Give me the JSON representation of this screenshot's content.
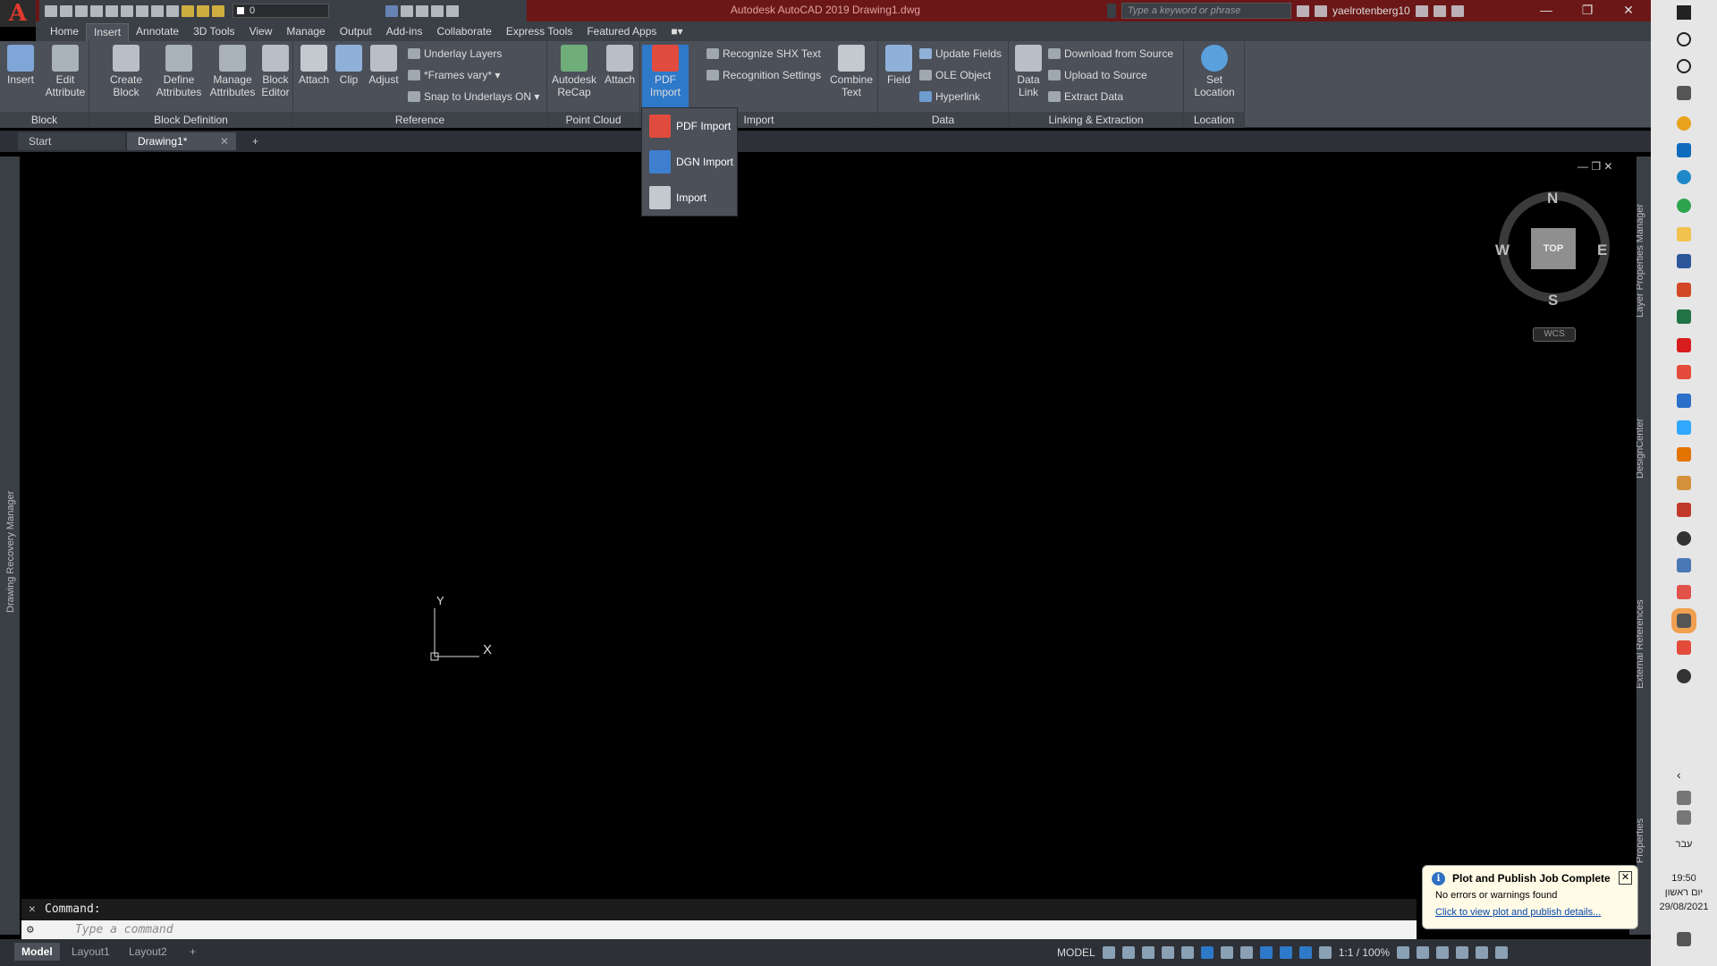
{
  "window": {
    "title": "Autodesk AutoCAD 2019   Drawing1.dwg",
    "search_placeholder": "Type a keyword or phrase",
    "user": "yaelrotenberg10",
    "layer_value": "0"
  },
  "ribbon_tabs": [
    "Home",
    "Insert",
    "Annotate",
    "3D Tools",
    "View",
    "Manage",
    "Output",
    "Add-ins",
    "Collaborate",
    "Express Tools",
    "Featured Apps"
  ],
  "ribbon": {
    "block": {
      "title": "Block",
      "insert": "Insert",
      "edit_attribute": "Edit Attribute"
    },
    "block_definition": {
      "title": "Block Definition",
      "create_block": "Create Block",
      "define_attributes": "Define Attributes",
      "manage_attributes": "Manage Attributes",
      "block_editor": "Block Editor"
    },
    "reference": {
      "title": "Reference",
      "attach": "Attach",
      "clip": "Clip",
      "adjust": "Adjust",
      "underlay_layers": "Underlay Layers",
      "frames_vary": "*Frames vary*",
      "snap_to_underlays": "Snap to Underlays ON"
    },
    "point_cloud": {
      "title": "Point Cloud",
      "recap": "Autodesk ReCap",
      "attach": "Attach"
    },
    "import": {
      "title": "Import",
      "pdf_import": "PDF Import",
      "recognize_shx": "Recognize SHX Text",
      "recognition_settings": "Recognition Settings",
      "combine_text": "Combine Text"
    },
    "data": {
      "title": "Data",
      "field": "Field",
      "update_fields": "Update Fields",
      "ole_object": "OLE Object",
      "hyperlink": "Hyperlink"
    },
    "linking": {
      "title": "Linking & Extraction",
      "data_link": "Data Link",
      "download_from_source": "Download from Source",
      "upload_to_source": "Upload to Source",
      "extract_data": "Extract  Data"
    },
    "location": {
      "title": "Location",
      "set_location": "Set Location"
    }
  },
  "pdf_dropdown": {
    "items": [
      "PDF Import",
      "DGN Import",
      "Import"
    ]
  },
  "doc_tabs": {
    "start": "Start",
    "drawing": "Drawing1*"
  },
  "palettes": {
    "left": "Drawing Recovery Manager",
    "right": [
      "Layer Properties Manager",
      "DesignCenter",
      "External References",
      "Properties"
    ]
  },
  "viewcube": {
    "n": "N",
    "s": "S",
    "e": "E",
    "w": "W",
    "face": "TOP",
    "wcs": "WCS"
  },
  "ucs": {
    "x": "X",
    "y": "Y"
  },
  "command": {
    "history": "Command:",
    "placeholder": "Type a command"
  },
  "layout_tabs": [
    "Model",
    "Layout1",
    "Layout2"
  ],
  "status": {
    "model": "MODEL",
    "scale": "1:1 / 100%"
  },
  "notification": {
    "title": "Plot and Publish Job Complete",
    "message": "No errors or warnings found",
    "link": "Click to view plot and publish details..."
  },
  "taskbar": {
    "time": "19:50",
    "day": "יום ראשון",
    "date": "29/08/2021",
    "language": "עבר"
  },
  "colors": {
    "title_bar": "#6b1717",
    "ribbon_bg": "#4b5059",
    "accent": "#2f79c9"
  }
}
